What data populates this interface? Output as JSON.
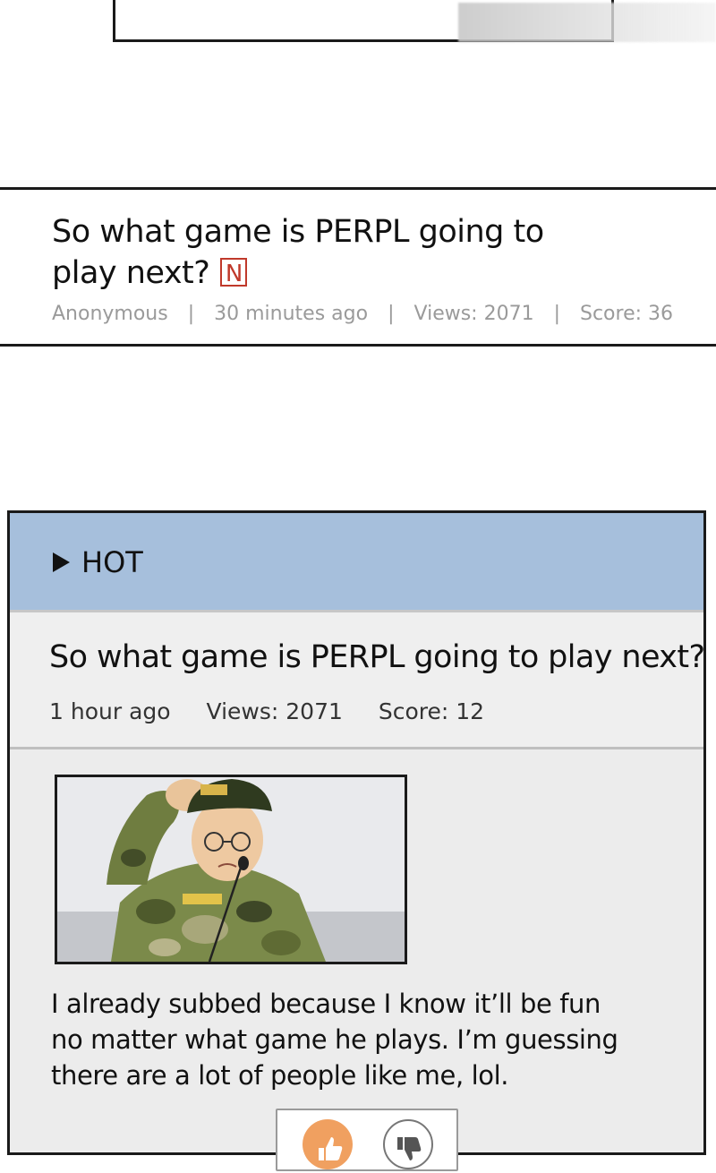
{
  "post": {
    "title": "So what game is PERPL going to play next?",
    "badge": "N",
    "author": "Anonymous",
    "time": "30 minutes ago",
    "views": "Views: 2071",
    "score": "Score: 36",
    "separator": "|"
  },
  "hot": {
    "label": "HOT",
    "title": "So what game is PERPL going to play next?",
    "time": "1 hour ago",
    "views": "Views: 2071",
    "score": "Score: 12",
    "body": "I already subbed because I know it’ll be fun no matter what game he plays. I’m guessing there are a lot of people like me, lol.",
    "colors": {
      "header_bg": "#a6bfdc",
      "upvote": "#f0a060",
      "badge": "#c0392b"
    },
    "icons": {
      "upvote": "thumbs-up-icon",
      "downvote": "thumbs-down-icon"
    }
  }
}
